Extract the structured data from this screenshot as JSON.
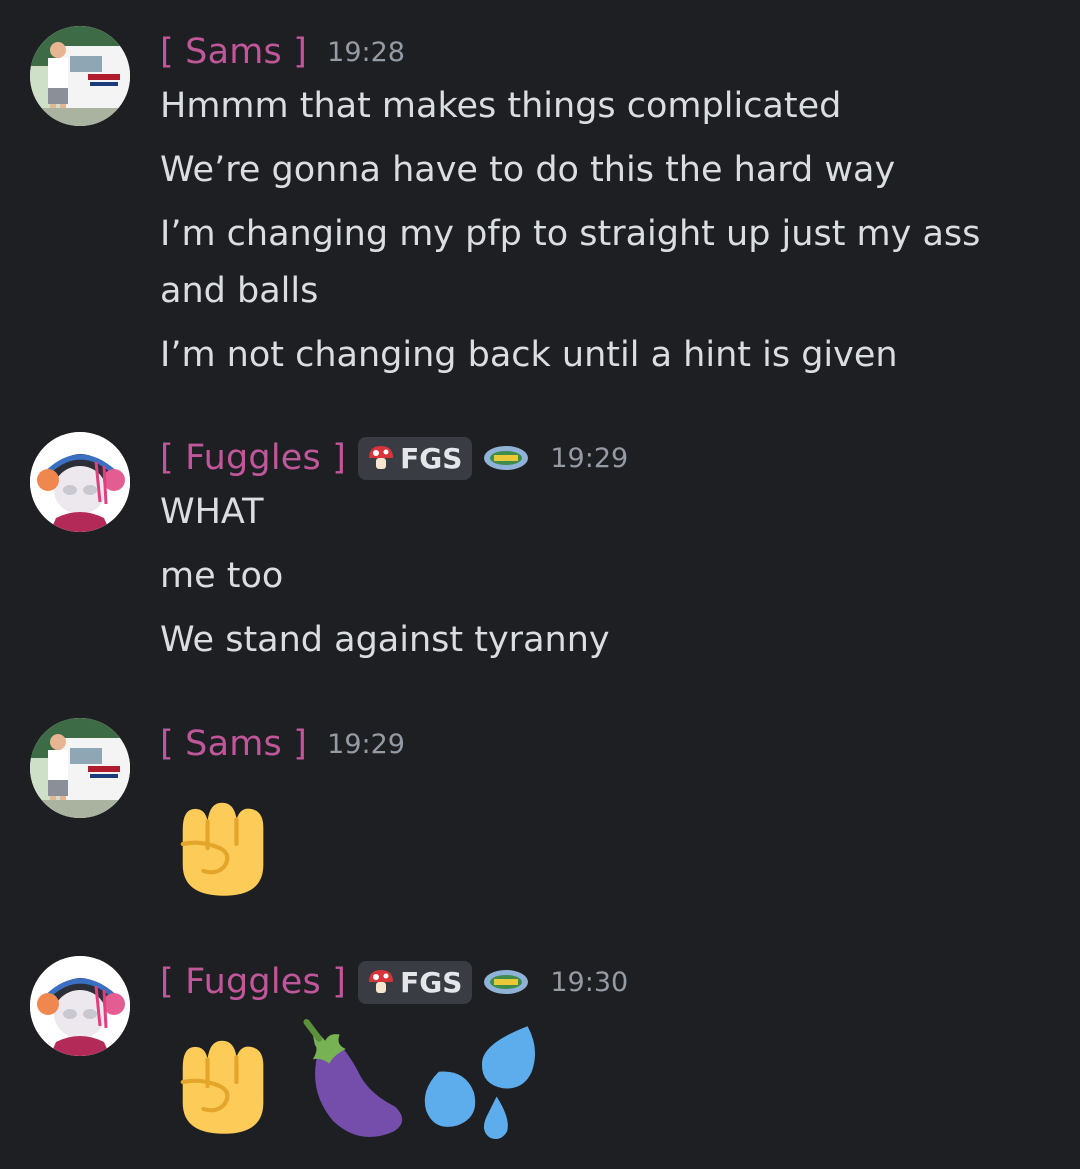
{
  "colors": {
    "background": "#1e1f22",
    "username": "#c0579a",
    "text": "#dbdee1",
    "timestamp": "#949ba4",
    "tag_bg": "#3a3c43"
  },
  "messages": [
    {
      "author": "[ Sams ]",
      "time": "19:28",
      "avatar": "sams-avatar",
      "lines": [
        "Hmmm that makes things complicated",
        "We’re gonna have to do this the hard way",
        "I’m changing my pfp to straight up just my ass and balls",
        "I’m not changing back until a hint is given"
      ]
    },
    {
      "author": "[ Fuggles ]",
      "time": "19:29",
      "avatar": "fuggles-avatar",
      "tag": "FGS",
      "tag_icon": "mushroom-icon",
      "lines": [
        "WHAT",
        "me too",
        "We stand against tyranny"
      ]
    },
    {
      "author": "[ Sams ]",
      "time": "19:29",
      "avatar": "sams-avatar",
      "emojis": [
        "raised-fist-emoji"
      ]
    },
    {
      "author": "[ Fuggles ]",
      "time": "19:30",
      "avatar": "fuggles-avatar",
      "tag": "FGS",
      "tag_icon": "mushroom-icon",
      "emojis": [
        "raised-fist-emoji",
        "eggplant-emoji",
        "sweat-droplets-emoji"
      ]
    }
  ]
}
